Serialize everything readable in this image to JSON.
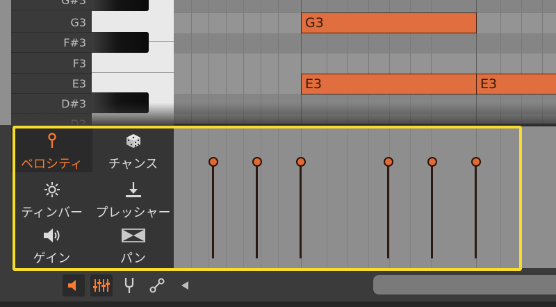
{
  "piano": {
    "keys": [
      {
        "label": "G#3",
        "black": true
      },
      {
        "label": "G3",
        "black": false
      },
      {
        "label": "F#3",
        "black": true
      },
      {
        "label": "F3",
        "black": false
      },
      {
        "label": "E3",
        "black": false
      },
      {
        "label": "D#3",
        "black": true
      },
      {
        "label": "D3",
        "black": false
      }
    ]
  },
  "notes": [
    {
      "label": "G3"
    },
    {
      "label": "E3"
    },
    {
      "label": "E3"
    }
  ],
  "expression": {
    "buttons": [
      {
        "id": "velocity",
        "label": "ベロシティ",
        "icon": "velocity-pin-icon",
        "active": true
      },
      {
        "id": "chance",
        "label": "チャンス",
        "icon": "dice-icon",
        "active": false
      },
      {
        "id": "timbre",
        "label": "ティンバー",
        "icon": "sun-icon",
        "active": false
      },
      {
        "id": "pressure",
        "label": "プレッシャー",
        "icon": "pressure-down-arrow-icon",
        "active": false
      },
      {
        "id": "gain",
        "label": "ゲイン",
        "icon": "speaker-icon",
        "active": false
      },
      {
        "id": "pan",
        "label": "パン",
        "icon": "pan-bowtie-icon",
        "active": false
      }
    ]
  },
  "toolbar": {
    "tools": [
      {
        "icon": "speaker-icon",
        "active": true
      },
      {
        "icon": "mixer-faders-icon",
        "active": true
      },
      {
        "icon": "tuning-fork-icon",
        "active": false
      },
      {
        "icon": "node-link-icon",
        "active": false
      },
      {
        "icon": "triangle-left-icon",
        "active": false
      }
    ]
  },
  "colors": {
    "accent": "#ff7a2e",
    "note_fill": "#e06e3e",
    "highlight": "#f7dc2c"
  }
}
